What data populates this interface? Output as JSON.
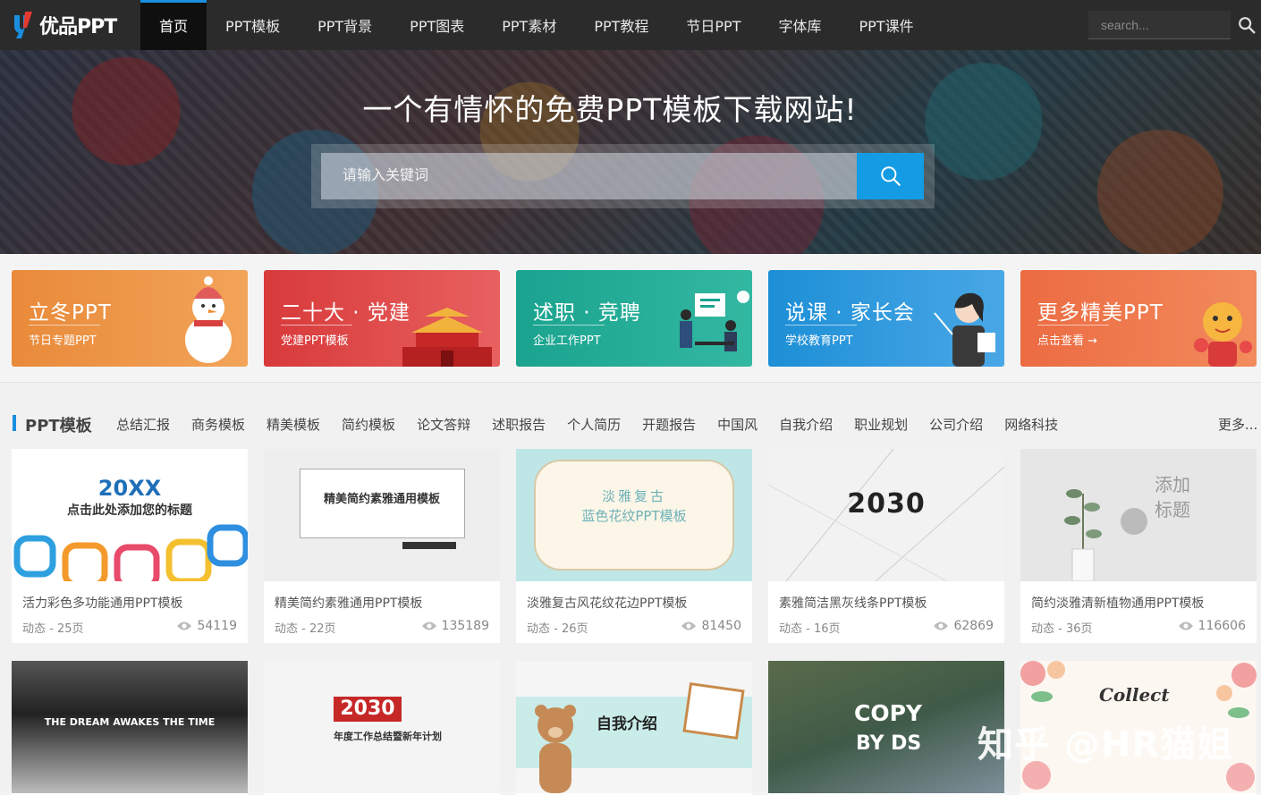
{
  "nav": {
    "logo": "优品PPT",
    "items": [
      {
        "label": "首页",
        "active": true
      },
      {
        "label": "PPT模板"
      },
      {
        "label": "PPT背景"
      },
      {
        "label": "PPT图表"
      },
      {
        "label": "PPT素材"
      },
      {
        "label": "PPT教程"
      },
      {
        "label": "节日PPT"
      },
      {
        "label": "字体库"
      },
      {
        "label": "PPT课件"
      }
    ],
    "search_placeholder": "search..."
  },
  "hero": {
    "title": "一个有情怀的免费PPT模板下载网站!",
    "search_placeholder": "请输入关键词"
  },
  "banners": [
    {
      "title": "立冬PPT",
      "subtitle": "节日专题PPT"
    },
    {
      "title": "二十大 · 党建",
      "subtitle": "党建PPT模板"
    },
    {
      "title": "述职 · 竞聘",
      "subtitle": "企业工作PPT"
    },
    {
      "title": "说课 · 家长会",
      "subtitle": "学校教育PPT"
    },
    {
      "title": "更多精美PPT",
      "subtitle": "点击查看 →"
    }
  ],
  "section": {
    "title": "PPT模板",
    "categories": [
      "总结汇报",
      "商务模板",
      "精美模板",
      "简约模板",
      "论文答辩",
      "述职报告",
      "个人简历",
      "开题报告",
      "中国风",
      "自我介绍",
      "职业规划",
      "公司介绍",
      "网络科技"
    ],
    "more": "更多..."
  },
  "cards": [
    {
      "title": "活力彩色多功能通用PPT模板",
      "meta": "动态 - 25页",
      "views": "54119",
      "thumb_main": "20XX",
      "thumb_sub": "点击此处添加您的标题"
    },
    {
      "title": "精美简约素雅通用PPT模板",
      "meta": "动态 - 22页",
      "views": "135189",
      "thumb_main": "精美简约素雅通用模板"
    },
    {
      "title": "淡雅复古风花纹花边PPT模板",
      "meta": "动态 - 26页",
      "views": "81450",
      "thumb_main": "淡雅复古",
      "thumb_sub": "蓝色花纹PPT模板"
    },
    {
      "title": "素雅简洁黑灰线条PPT模板",
      "meta": "动态 - 16页",
      "views": "62869",
      "thumb_main": "2030"
    },
    {
      "title": "简约淡雅清新植物通用PPT模板",
      "meta": "动态 - 36页",
      "views": "116606",
      "thumb_main": "添加标题"
    },
    {
      "thumb_main": "THE DREAM AWAKES THE TIME"
    },
    {
      "thumb_main": "2030",
      "thumb_sub": "年度工作总结暨新年计划"
    },
    {
      "thumb_main": "自我介绍"
    },
    {
      "thumb_main": "COPY",
      "thumb_sub": "BY DS"
    },
    {
      "thumb_main": "Collect"
    }
  ],
  "watermark": "知乎 @HR猫姐",
  "colors": {
    "accent": "#1a8fe0",
    "nav_bg": "#2b2b2b",
    "search_btn": "#139be3"
  }
}
